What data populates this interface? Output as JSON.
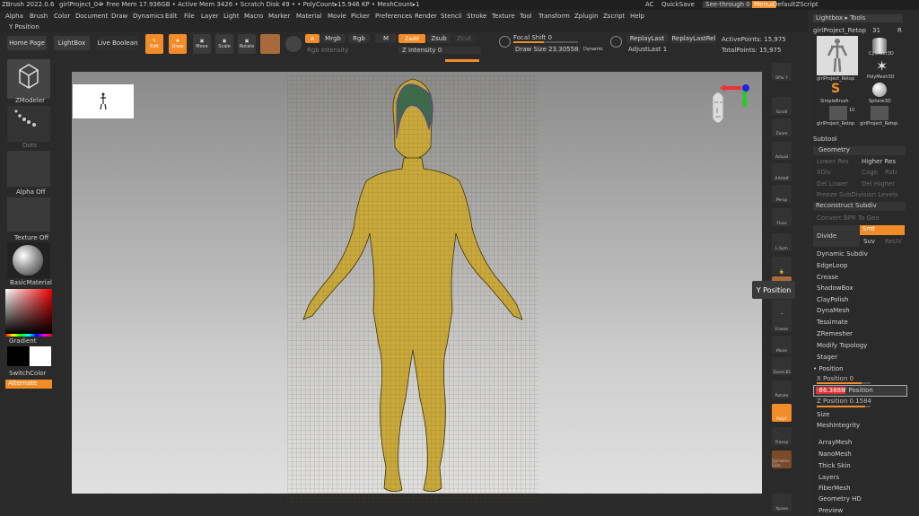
{
  "titlebar": {
    "app": "ZBrush 2022.0.6",
    "project": "girlProject_04",
    "stats": "• Free Mem 17.936GB • Active Mem 3426 • Scratch Disk 49 • • PolyCount▸15.946 KP • MeshCount▸1",
    "ac": "AC",
    "quicksave": "QuickSave",
    "seethrough": "See-through  0",
    "menus": "Menus",
    "script": "DefaultZScript"
  },
  "menu": [
    "Alpha",
    "Brush",
    "Color",
    "Document",
    "Draw",
    "Dynamics",
    "Edit",
    "File",
    "Layer",
    "Light",
    "Macro",
    "Marker",
    "Material",
    "Movie",
    "Picker",
    "Preferences",
    "Render",
    "Stencil",
    "Stroke",
    "Texture",
    "Tool",
    "Transform",
    "Zplugin",
    "Zscript",
    "Help"
  ],
  "info_label": "Y Position",
  "toolbar": {
    "home": "Home Page",
    "lightbox": "LightBox",
    "liveboolean": "Live Boolean",
    "edit": "Edit",
    "draw": "Draw",
    "move": "Move",
    "scale": "Scale",
    "rotate": "Rotate",
    "a": "A",
    "mrgb": "Mrgb",
    "rgb": "Rgb",
    "m": "M",
    "zadd": "Zadd",
    "zsub": "Zsub",
    "zcut": "Zcut",
    "rgb_intensity": "Rgb Intensity",
    "z_intensity": "Z Intensity 0",
    "focal_shift": "Focal Shift 0",
    "draw_size": "Draw Size 23.30558",
    "dynamic": "Dynamic",
    "replaylast": "ReplayLast",
    "replaylastrel": "ReplayLastRel",
    "adjustlast": "AdjustLast 1",
    "active_points": "ActivePoints: 15,975",
    "total_points": "TotalPoints: 15,975"
  },
  "left": {
    "zmodeler": "ZModeler",
    "dots": "Dots",
    "alpha_off": "Alpha Off",
    "texture_off": "Texture Off",
    "basic_material": "BasicMaterial",
    "gradient": "Gradient",
    "switchcolor": "SwitchColor",
    "alternate": "Alternate"
  },
  "rightshelf": [
    "SPix 7",
    "Scroll",
    "Zoom",
    "Actual",
    "AAHalf",
    "Persp",
    "Floor",
    "L.Sym",
    "",
    "",
    "",
    "Frame",
    "Move",
    "Zoom3D",
    "Rotate",
    "PolyF",
    "Transp",
    "Dynamic Solo",
    "Xpose"
  ],
  "tooltip": "Y Position",
  "panel": {
    "header": "Lightbox ▸ Tools",
    "tool_name": "girlProject_Retop",
    "tool_count": "31",
    "r": "R",
    "tools": [
      "girlProject_Retop",
      "Cylinder3D",
      "PolyMesh3D",
      "SimpleBrush",
      "Sphere3D",
      "girlProject_Retop",
      "girlProject_Retop"
    ],
    "badge": "10",
    "subtool": "Subtool",
    "geometry": "Geometry",
    "lower_res": "Lower Res",
    "higher_res": "Higher Res",
    "sdiv": "SDiv",
    "cage": "Cage",
    "rstr": "Rstr",
    "del_lower": "Del Lower",
    "del_higher": "Del Higher",
    "freeze": "Freeze SubDivision Levels",
    "reconstruct": "Reconstruct Subdiv",
    "convert_bpr": "Convert BPR To Geo",
    "divide": "Divide",
    "smt": "Smt",
    "suv": "Suv",
    "reuv": "ReUV",
    "items": [
      "Dynamic Subdiv",
      "EdgeLoop",
      "Crease",
      "ShadowBox",
      "ClayPolish",
      "DynaMesh",
      "Tessimate",
      "ZRemesher",
      "Modify Topology",
      "Stager"
    ],
    "position": "Position",
    "x_pos": "X Position 0",
    "y_val": "-86.3888",
    "y_label": "Y Position",
    "z_pos": "Z Position 0.1584",
    "size": "Size",
    "meshintegrity": "MeshIntegrity",
    "bottom": [
      "ArrayMesh",
      "NanoMesh",
      "Thick Skin",
      "Layers",
      "FiberMesh",
      "Geometry HD",
      "Preview"
    ]
  }
}
